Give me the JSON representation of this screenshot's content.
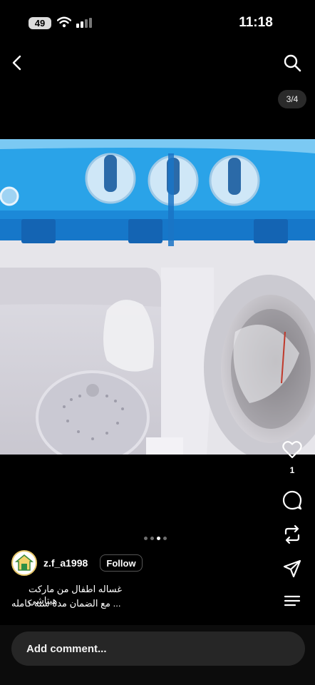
{
  "status_bar": {
    "battery": "49",
    "time": "11:18"
  },
  "header": {
    "image_counter": "3/4"
  },
  "post": {
    "likes": "1",
    "carousel": {
      "total": 4,
      "active_index": 3
    },
    "author": {
      "username": "z.f_a1998",
      "follow_label": "Follow"
    },
    "caption_line1": "غساله اطفال من ماركت هيتاشي",
    "caption_line2": "مع الضمان مده سنه كامله ..."
  },
  "comment": {
    "placeholder": "Add comment..."
  },
  "icons": [
    "signal-icon",
    "wifi-icon",
    "cellular-icon",
    "back-icon",
    "search-icon",
    "heart-icon",
    "comment-icon",
    "repost-icon",
    "share-icon",
    "menu-icon"
  ],
  "colors": {
    "machine_blue": "#1f8fd6",
    "machine_white": "#e9e8ec"
  }
}
